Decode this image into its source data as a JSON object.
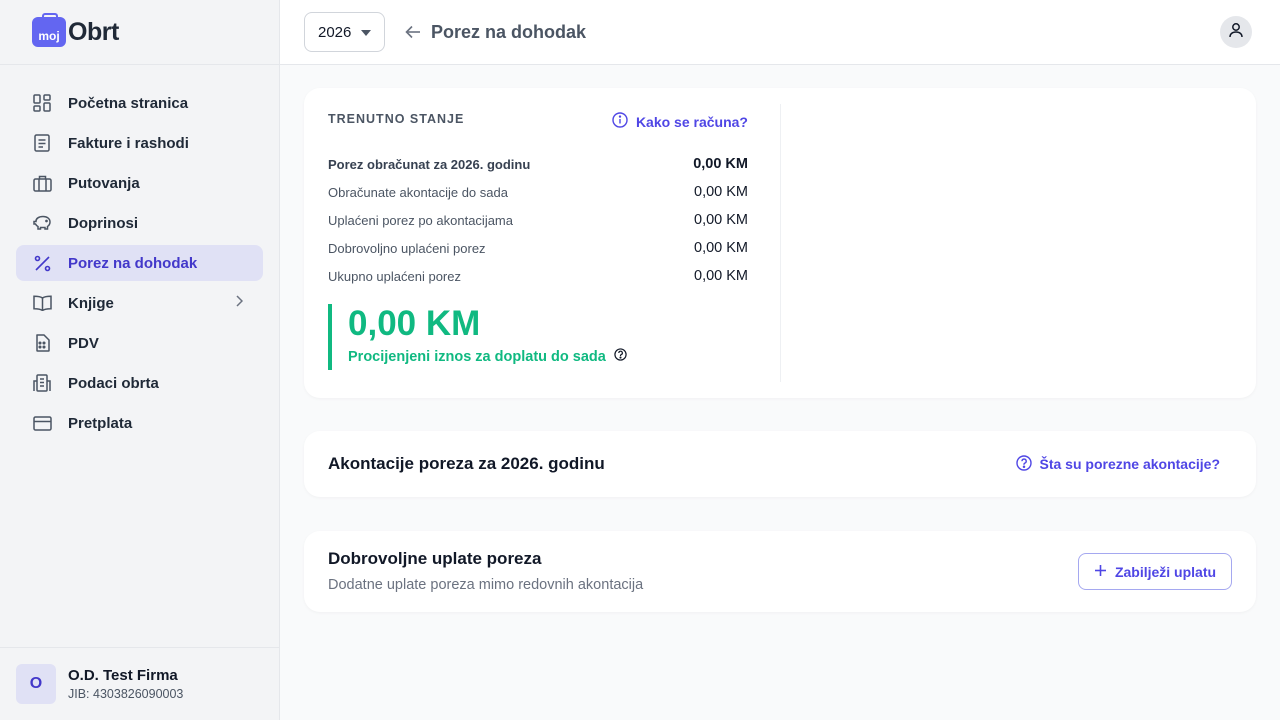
{
  "brand": {
    "logo_badge": "moj",
    "logo_text": "Obrt",
    "accent": "#6366f1"
  },
  "sidebar": {
    "items": [
      {
        "label": "Početna stranica",
        "icon": "dashboard-icon"
      },
      {
        "label": "Fakture i rashodi",
        "icon": "document-icon"
      },
      {
        "label": "Putovanja",
        "icon": "briefcase-icon"
      },
      {
        "label": "Doprinosi",
        "icon": "piggy-bank-icon"
      },
      {
        "label": "Porez na dohodak",
        "icon": "percent-icon",
        "active": true
      },
      {
        "label": "Knjige",
        "icon": "book-icon",
        "has_submenu": true
      },
      {
        "label": "PDV",
        "icon": "calculator-icon"
      },
      {
        "label": "Podaci obrta",
        "icon": "building-icon"
      },
      {
        "label": "Pretplata",
        "icon": "credit-card-icon"
      }
    ]
  },
  "user": {
    "initial": "O",
    "name": "O.D. Test Firma",
    "jib": "JIB: 4303826090003"
  },
  "header": {
    "year": "2026",
    "title": "Porez na dohodak"
  },
  "status": {
    "section_label": "TRENUTNO STANJE",
    "help_link": "Kako se računa?",
    "rows": [
      {
        "label": "Porez obračunat za 2026. godinu",
        "value": "0,00 KM",
        "bold": true
      },
      {
        "label": "Obračunate akontacije do sada",
        "value": "0,00 KM"
      },
      {
        "label": "Uplaćeni porez po akontacijama",
        "value": "0,00 KM"
      },
      {
        "label": "Dobrovoljno uplaćeni porez",
        "value": "0,00 KM"
      },
      {
        "label": "Ukupno uplaćeni porez",
        "value": "0,00 KM"
      }
    ],
    "estimate_amount": "0,00 KM",
    "estimate_label": "Procijenjeni iznos za doplatu do sada",
    "estimate_color": "#10b981"
  },
  "advances": {
    "title": "Akontacije poreza za 2026. godinu",
    "help_link": "Šta su porezne akontacije?"
  },
  "voluntary": {
    "title": "Dobrovoljne uplate poreza",
    "subtitle": "Dodatne uplate poreza mimo redovnih akontacija",
    "button_label": "Zabilježi uplatu"
  }
}
